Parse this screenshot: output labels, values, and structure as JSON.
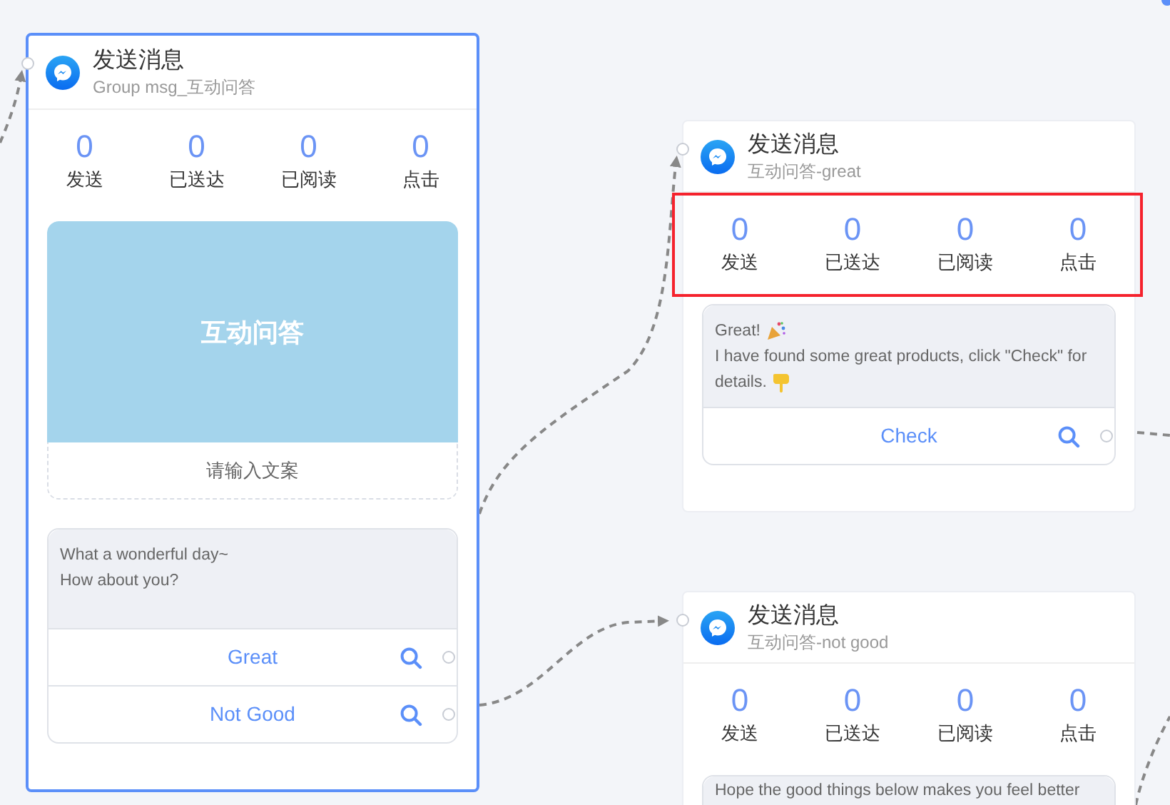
{
  "nodes": [
    {
      "kind": "message",
      "selected": true,
      "highlighted": false,
      "title": "发送消息",
      "subtitle": "Group msg_互动问答",
      "stats": [
        {
          "value": "0",
          "label": "发送"
        },
        {
          "value": "0",
          "label": "已送达"
        },
        {
          "value": "0",
          "label": "已阅读"
        },
        {
          "value": "0",
          "label": "点击"
        }
      ],
      "cards": [
        {
          "kind": "image",
          "title": "互动问答",
          "caption": "请输入文案"
        },
        {
          "kind": "text",
          "paragraphs": [
            {
              "text": "What a wonderful day~"
            },
            {
              "text": "How about you?"
            }
          ],
          "buttons": [
            "Great",
            "Not Good"
          ]
        }
      ]
    },
    {
      "kind": "message",
      "selected": false,
      "highlighted": true,
      "title": "发送消息",
      "subtitle": "互动问答-great",
      "stats": [
        {
          "value": "0",
          "label": "发送"
        },
        {
          "value": "0",
          "label": "已送达"
        },
        {
          "value": "0",
          "label": "已阅读"
        },
        {
          "value": "0",
          "label": "点击"
        }
      ],
      "cards": [
        {
          "kind": "text",
          "paragraphs": [
            {
              "text": "Great!"
            },
            {
              "text": "I have found some great products, click \"Check\" for"
            },
            {
              "text": "details."
            }
          ],
          "buttons": [
            "Check"
          ]
        }
      ]
    },
    {
      "kind": "message",
      "selected": false,
      "highlighted": false,
      "title": "发送消息",
      "subtitle": "互动问答-not good",
      "stats": [
        {
          "value": "0",
          "label": "发送"
        },
        {
          "value": "0",
          "label": "已送达"
        },
        {
          "value": "0",
          "label": "已阅读"
        },
        {
          "value": "0",
          "label": "点击"
        }
      ],
      "cards": [
        {
          "kind": "text",
          "paragraphs": [
            {
              "text": "Hope the good things below makes you feel better"
            }
          ]
        }
      ]
    }
  ]
}
